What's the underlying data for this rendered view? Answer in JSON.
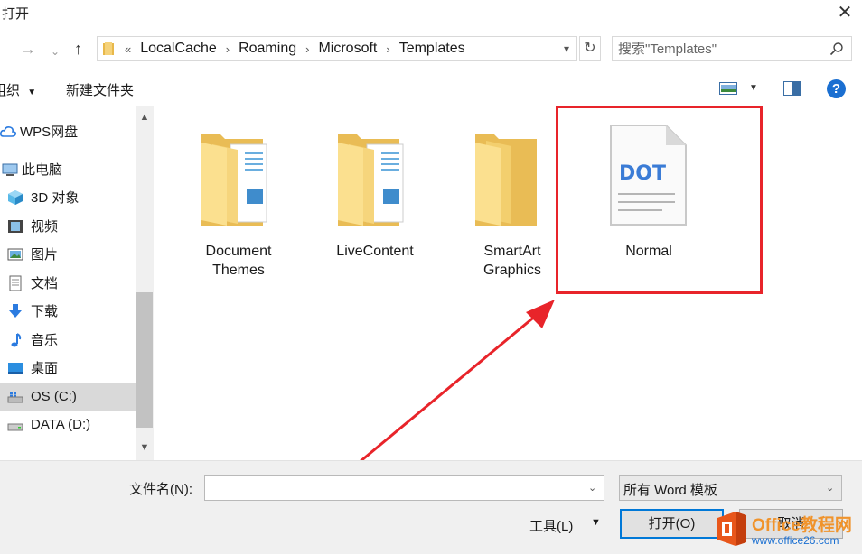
{
  "window": {
    "title": "打开",
    "close_glyph": "✕"
  },
  "address": {
    "overflow_glyph": "«",
    "crumbs": [
      "LocalCache",
      "Roaming",
      "Microsoft",
      "Templates"
    ],
    "search_placeholder": "搜索\"Templates\""
  },
  "toolbar": {
    "organize_label": "组织",
    "new_folder_label": "新建文件夹"
  },
  "sidebar": {
    "items": [
      {
        "label": "WPS网盘",
        "icon": "cloud-icon"
      },
      {
        "label": "此电脑",
        "icon": "computer-icon"
      },
      {
        "label": "3D 对象",
        "icon": "3d-objects-icon"
      },
      {
        "label": "视频",
        "icon": "video-icon"
      },
      {
        "label": "图片",
        "icon": "pictures-icon"
      },
      {
        "label": "文档",
        "icon": "documents-icon"
      },
      {
        "label": "下载",
        "icon": "download-icon"
      },
      {
        "label": "音乐",
        "icon": "music-icon"
      },
      {
        "label": "桌面",
        "icon": "desktop-icon"
      },
      {
        "label": "OS (C:)",
        "icon": "drive-icon",
        "selected": true
      },
      {
        "label": "DATA (D:)",
        "icon": "drive-icon"
      }
    ]
  },
  "files": [
    {
      "name_line1": "Document",
      "name_line2": "Themes",
      "type": "folder"
    },
    {
      "name_line1": "LiveContent",
      "name_line2": "",
      "type": "folder"
    },
    {
      "name_line1": "SmartArt",
      "name_line2": "Graphics",
      "type": "folder"
    },
    {
      "name_line1": "Normal",
      "name_line2": "",
      "type": "dot-file",
      "badge": "DOT"
    }
  ],
  "footer": {
    "filename_label": "文件名(N):",
    "filename_value": "",
    "filetype_value": "所有 Word 模板",
    "tools_label": "工具(L)",
    "open_label": "打开(O)",
    "cancel_label": "取消"
  },
  "watermark": {
    "line1": "Office教程网",
    "line2": "www.office26.com"
  },
  "colors": {
    "highlight": "#e8242a",
    "accent": "#1a6fd1",
    "folder": "#f5cf6b",
    "watermark_orange": "#f0932b"
  }
}
